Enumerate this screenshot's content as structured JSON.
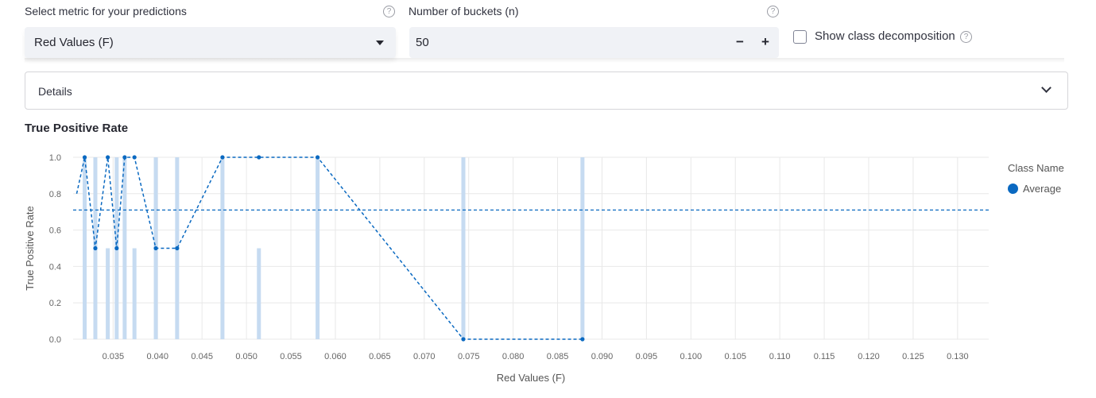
{
  "controls": {
    "metric_label": "Select metric for your predictions",
    "metric_value": "Red Values (F)",
    "buckets_label": "Number of buckets (n)",
    "buckets_value": "50",
    "minus": "−",
    "plus": "+",
    "decomposition_label": "Show class decomposition",
    "help": "?"
  },
  "details": {
    "label": "Details"
  },
  "chart": {
    "section_title": "True Positive Rate"
  },
  "colors": {
    "accent": "#0a69c1",
    "bar": "#c6dbf1",
    "grid": "#e8e8e8"
  },
  "icons": {
    "help": "question-circle-icon",
    "dropdown": "caret-down-icon",
    "expand": "chevron-down-icon"
  },
  "chart_data": {
    "type": "line",
    "xlabel": "Red Values (F)",
    "ylabel": "True Positive Rate",
    "xlim": [
      0.0305,
      0.1335
    ],
    "ylim": [
      0,
      1.0
    ],
    "x_ticks": [
      "0.035",
      "0.040",
      "0.045",
      "0.050",
      "0.055",
      "0.060",
      "0.065",
      "0.070",
      "0.075",
      "0.080",
      "0.085",
      "0.090",
      "0.095",
      "0.100",
      "0.105",
      "0.110",
      "0.115",
      "0.120",
      "0.125",
      "0.130"
    ],
    "y_ticks": [
      "0.0",
      "0.2",
      "0.4",
      "0.6",
      "0.8",
      "1.0"
    ],
    "legend_title": "Class Name",
    "legend_position": "right",
    "grid": true,
    "series": [
      {
        "name": "Average",
        "x": [
          0.0309,
          0.0318,
          0.033,
          0.0344,
          0.0354,
          0.0363,
          0.0374,
          0.0398,
          0.0422,
          0.0473,
          0.0514,
          0.058,
          0.0744,
          0.0878
        ],
        "y": [
          0.8,
          1.0,
          0.5,
          1.0,
          0.5,
          1.0,
          1.0,
          0.5,
          0.5,
          1.0,
          1.0,
          1.0,
          0.0,
          0.0
        ]
      }
    ],
    "reference_line": 0.71,
    "bars": {
      "x": [
        0.0318,
        0.033,
        0.0344,
        0.0354,
        0.0363,
        0.0374,
        0.0398,
        0.0422,
        0.0473,
        0.0514,
        0.058,
        0.0744,
        0.0878
      ],
      "y": [
        1.0,
        1.0,
        0.5,
        1.0,
        1.0,
        0.5,
        1.0,
        1.0,
        1.0,
        0.5,
        1.0,
        1.0,
        1.0
      ]
    }
  }
}
